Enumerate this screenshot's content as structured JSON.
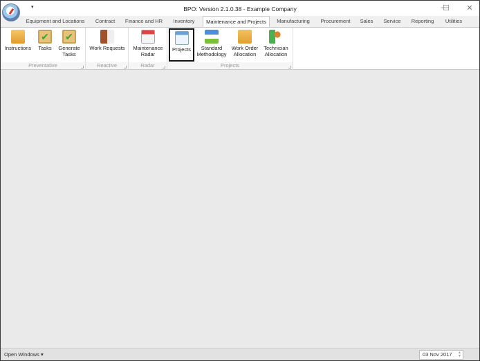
{
  "window": {
    "title": "BPO: Version 2.1.0.38 - Example Company",
    "quick_access": "▾",
    "minimize": "—",
    "maximize": "☐",
    "close": "✕"
  },
  "tabs": [
    {
      "label": "Equipment and Locations"
    },
    {
      "label": "Contract"
    },
    {
      "label": "Finance and HR"
    },
    {
      "label": "Inventory"
    },
    {
      "label": "Maintenance and Projects",
      "active": true
    },
    {
      "label": "Manufacturing"
    },
    {
      "label": "Procurement"
    },
    {
      "label": "Sales"
    },
    {
      "label": "Service"
    },
    {
      "label": "Reporting"
    },
    {
      "label": "Utilities"
    }
  ],
  "groups": {
    "preventative": "Preventative",
    "reactive": "Reactive",
    "radar": "Radar",
    "projects": "Projects"
  },
  "buttons": {
    "instructions": {
      "label": "Instructions",
      "icon": "notepad-icon"
    },
    "tasks": {
      "label": "Tasks",
      "icon": "clipboard-check-icon"
    },
    "generate_tasks": {
      "line1": "Generate",
      "line2": "Tasks",
      "icon": "clipboard-star-icon"
    },
    "work_requests": {
      "label": "Work Requests",
      "icon": "briefcase-document-icon"
    },
    "maintenance_radar": {
      "line1": "Maintenance",
      "line2": "Radar",
      "icon": "calendar-icon"
    },
    "projects": {
      "label": "Projects",
      "icon": "project-board-icon",
      "selected": true
    },
    "standard_methodology": {
      "line1": "Standard",
      "line2": "Methodology",
      "icon": "hierarchy-icon"
    },
    "work_order_allocation": {
      "line1": "Work Order",
      "line2": "Allocation",
      "icon": "folder-search-icon"
    },
    "technician_allocation": {
      "line1": "Technician",
      "line2": "Allocation",
      "icon": "user-arrow-icon"
    }
  },
  "status": {
    "open_windows": "Open Windows ▾",
    "date": "03 Nov 2017"
  }
}
